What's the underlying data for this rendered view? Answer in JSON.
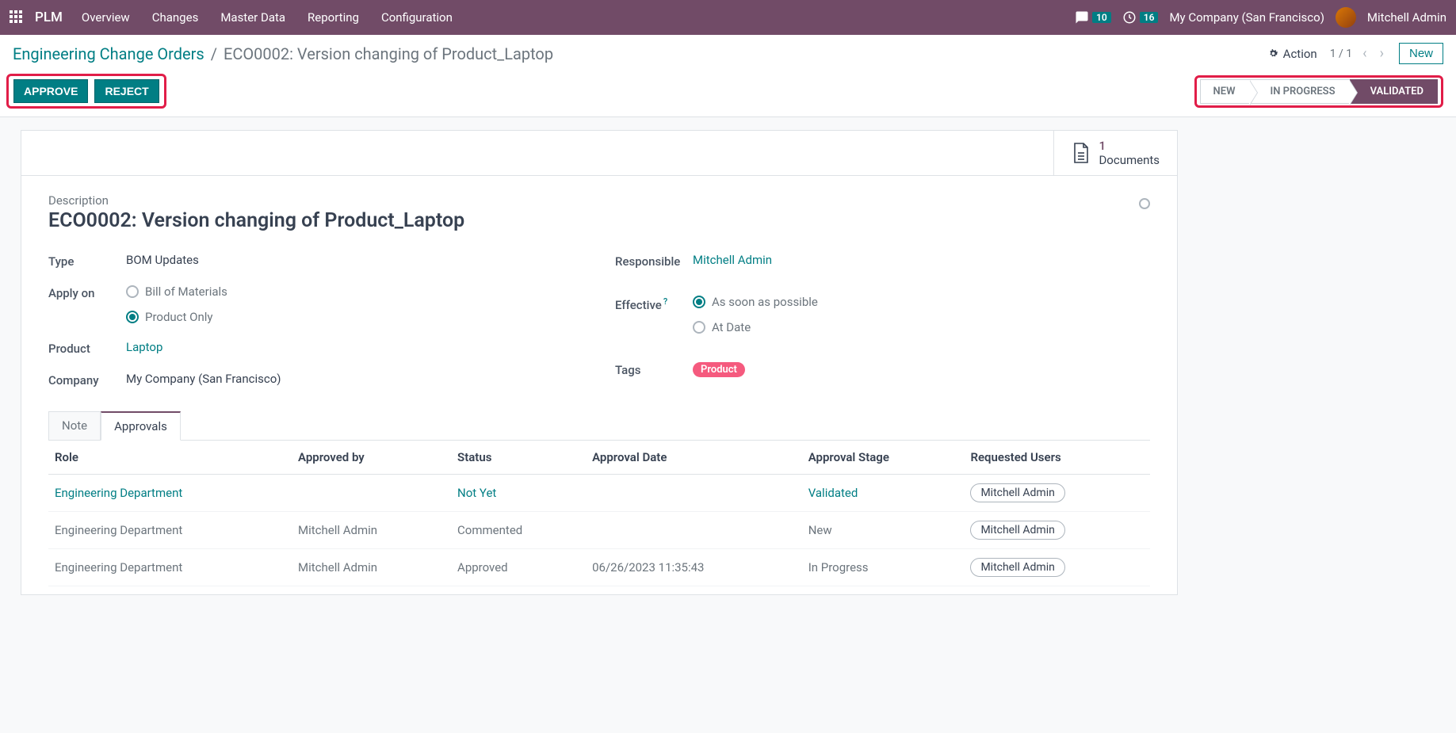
{
  "navbar": {
    "brand": "PLM",
    "menu": [
      "Overview",
      "Changes",
      "Master Data",
      "Reporting",
      "Configuration"
    ],
    "messages_badge": "10",
    "activities_badge": "16",
    "company": "My Company (San Francisco)",
    "user": "Mitchell Admin"
  },
  "breadcrumb": {
    "parent": "Engineering Change Orders",
    "current": "ECO0002: Version changing of Product_Laptop"
  },
  "cp": {
    "action_label": "Action",
    "pager": "1 / 1",
    "new_label": "New",
    "approve_label": "APPROVE",
    "reject_label": "REJECT"
  },
  "statusbar": [
    "NEW",
    "IN PROGRESS",
    "VALIDATED"
  ],
  "buttonbox": {
    "documents_count": "1",
    "documents_label": "Documents"
  },
  "form": {
    "description_label": "Description",
    "title": "ECO0002: Version changing of Product_Laptop",
    "type_label": "Type",
    "type_value": "BOM Updates",
    "applyon_label": "Apply on",
    "applyon_bom": "Bill of Materials",
    "applyon_product": "Product Only",
    "product_label": "Product",
    "product_value": "Laptop",
    "company_label": "Company",
    "company_value": "My Company (San Francisco)",
    "responsible_label": "Responsible",
    "responsible_value": "Mitchell Admin",
    "effective_label": "Effective",
    "effective_asap": "As soon as possible",
    "effective_atdate": "At Date",
    "tags_label": "Tags",
    "tag_product": "Product"
  },
  "tabs": {
    "note": "Note",
    "approvals": "Approvals"
  },
  "approvals": {
    "headers": {
      "role": "Role",
      "approved_by": "Approved by",
      "status": "Status",
      "approval_date": "Approval Date",
      "approval_stage": "Approval Stage",
      "requested_users": "Requested Users"
    },
    "rows": [
      {
        "role": "Engineering Department",
        "role_link": true,
        "approved_by": "",
        "status": "Not Yet",
        "status_link": true,
        "date": "",
        "stage": "Validated",
        "stage_link": true,
        "user": "Mitchell Admin"
      },
      {
        "role": "Engineering Department",
        "role_link": false,
        "approved_by": "Mitchell Admin",
        "status": "Commented",
        "status_link": false,
        "date": "",
        "stage": "New",
        "stage_link": false,
        "user": "Mitchell Admin"
      },
      {
        "role": "Engineering Department",
        "role_link": false,
        "approved_by": "Mitchell Admin",
        "status": "Approved",
        "status_link": false,
        "date": "06/26/2023 11:35:43",
        "stage": "In Progress",
        "stage_link": false,
        "user": "Mitchell Admin"
      }
    ]
  }
}
